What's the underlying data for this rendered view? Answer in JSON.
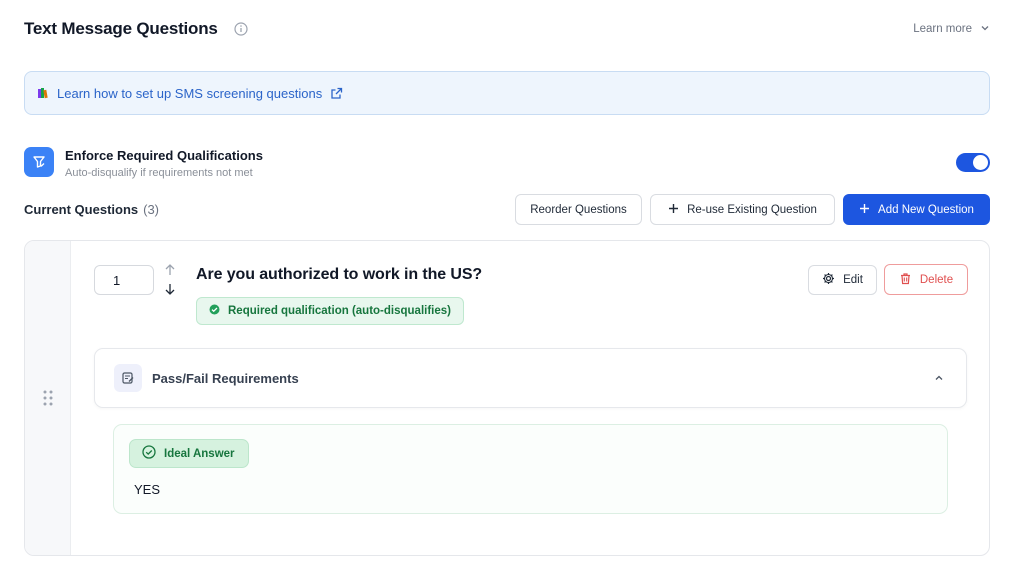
{
  "header": {
    "title": "Text Message Questions",
    "learn_more": "Learn more"
  },
  "banner": {
    "link_text": "Learn how to set up SMS screening questions"
  },
  "enforce": {
    "title": "Enforce Required Qualifications",
    "subtitle": "Auto-disqualify if requirements not met",
    "toggle_on": true
  },
  "current_questions": {
    "label": "Current Questions",
    "count": "(3)",
    "reorder_label": "Reorder Questions",
    "reuse_label": "Re-use Existing Question",
    "add_label": "Add New Question"
  },
  "question": {
    "number": "1",
    "title": "Are you authorized to work in the US?",
    "required_badge": "Required qualification (auto-disqualifies)",
    "edit_label": "Edit",
    "delete_label": "Delete",
    "passfail_label": "Pass/Fail Requirements",
    "ideal_label": "Ideal Answer",
    "ideal_answer": "YES"
  },
  "icons": {
    "info": "info-icon",
    "chevron_down": "chevron-down-icon",
    "books": "books-icon",
    "external_link": "external-link-icon",
    "enforce": "filter-icon",
    "plus": "plus-icon",
    "drag": "drag-handle-icon",
    "arrow_up": "arrow-up-icon",
    "arrow_down": "arrow-down-icon",
    "check_circle": "check-circle-icon",
    "gear": "gear-icon",
    "trash": "trash-icon",
    "edit_note": "edit-note-icon",
    "chevron_up": "chevron-up-icon"
  },
  "colors": {
    "primary": "#1d56e0",
    "banner_bg": "#eef5fd",
    "banner_link": "#2b64c9",
    "success_text": "#17763e",
    "success_bg": "#e8f7ee",
    "danger": "#e04f4f"
  }
}
